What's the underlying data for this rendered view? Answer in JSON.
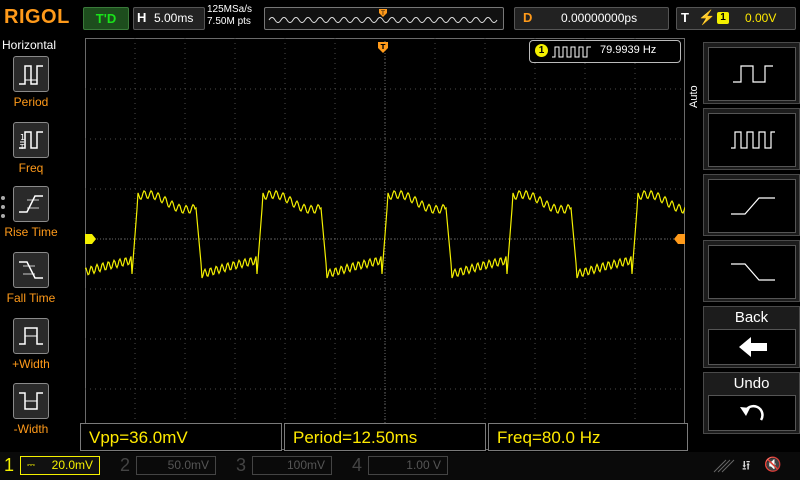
{
  "brand": "RIGOL",
  "trigger_status": "T'D",
  "horizontal": {
    "label": "H",
    "value": "5.00ms"
  },
  "sample_info": {
    "rate": "125MSa/s",
    "points": "7.50M pts"
  },
  "delay": {
    "label": "D",
    "value": "0.00000000ps"
  },
  "trigger": {
    "label": "T",
    "channel": "1",
    "level": "0.00V"
  },
  "left_menu": {
    "title": "Horizontal",
    "items": [
      "Period",
      "Freq",
      "Rise Time",
      "Fall Time",
      "+Width",
      "-Width"
    ]
  },
  "right_menu": {
    "mode": "Auto",
    "back_label": "Back",
    "undo_label": "Undo"
  },
  "freq_counter": {
    "channel": "1",
    "value": "79.9939 Hz"
  },
  "measurements": [
    "Vpp=36.0mV",
    "Period=12.50ms",
    "Freq=80.0 Hz"
  ],
  "channels": [
    {
      "num": "1",
      "scale": "20.0mV",
      "color": "#f4f000",
      "active": true
    },
    {
      "num": "2",
      "scale": "50.0mV",
      "color": "#00d5d5",
      "active": false
    },
    {
      "num": "3",
      "scale": "100mV",
      "color": "#d020d0",
      "active": false
    },
    {
      "num": "4",
      "scale": "1.00 V",
      "color": "#2a6fe0",
      "active": false
    }
  ],
  "colors": {
    "ch1": "#f4f000",
    "accent": "#ff9a1a",
    "grid": "#4a4a4a"
  }
}
